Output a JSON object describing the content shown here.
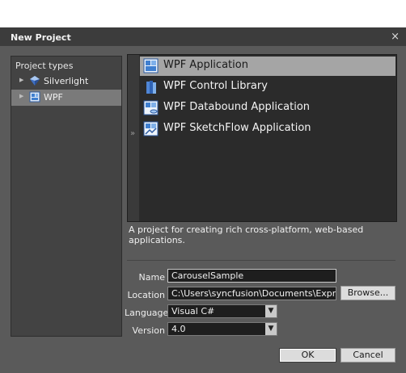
{
  "window": {
    "title": "New Project",
    "close_glyph": "×"
  },
  "project_types": {
    "header": "Project types",
    "items": [
      {
        "label": "Silverlight",
        "icon": "silverlight-icon",
        "selected": false
      },
      {
        "label": "WPF",
        "icon": "wpf-icon",
        "selected": true
      }
    ]
  },
  "templates": {
    "collapse_glyph": "»",
    "items": [
      {
        "label": "WPF Application",
        "icon": "wpf-application-icon",
        "selected": true
      },
      {
        "label": "WPF Control Library",
        "icon": "control-library-icon",
        "selected": false
      },
      {
        "label": "WPF Databound Application",
        "icon": "databound-application-icon",
        "selected": false
      },
      {
        "label": "WPF SketchFlow Application",
        "icon": "sketchflow-application-icon",
        "selected": false
      }
    ]
  },
  "description": "A project for creating rich cross-platform, web-based applications.",
  "form": {
    "name_label": "Name",
    "name_value": "CarouselSample",
    "location_label": "Location",
    "location_value": "C:\\Users\\syncfusion\\Documents\\Expression",
    "browse_label": "Browse...",
    "language_label": "Language",
    "language_value": "Visual C#",
    "version_label": "Version",
    "version_value": "4.0"
  },
  "buttons": {
    "ok": "OK",
    "cancel": "Cancel"
  },
  "colors": {
    "dialog_bg": "#5a5a5a",
    "list_bg": "#2b2b2b",
    "selection": "#a5a5a5"
  }
}
